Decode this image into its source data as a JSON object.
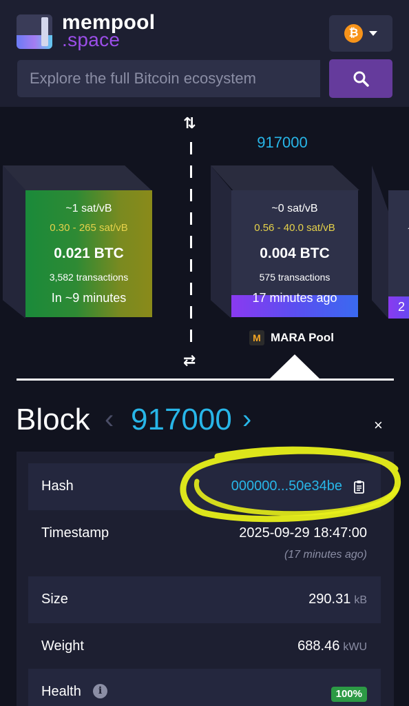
{
  "header": {
    "logo_line1": "mempool",
    "logo_line2": ".space",
    "network_icon": "bitcoin-icon",
    "search_placeholder": "Explore the full Bitcoin ecosystem",
    "search_icon": "search-icon"
  },
  "blockchain": {
    "selected_height": "917000",
    "pending_block": {
      "fee_median": "~1 sat/vB",
      "fee_range": "0.30 - 265 sat/vB",
      "total": "0.021 BTC",
      "tx_count": "3,582 transactions",
      "eta": "In ~9 minutes"
    },
    "confirmed_block": {
      "fee_median": "~0 sat/vB",
      "fee_range": "0.56 - 40.0 sat/vB",
      "total": "0.004 BTC",
      "tx_count": "575 transactions",
      "time_ago": "17 minutes ago",
      "pool_icon_letter": "M",
      "pool_name": "MARA Pool"
    },
    "next_block_peek": {
      "top": "~",
      "bottom": "2"
    }
  },
  "block": {
    "title": "Block",
    "height": "917000",
    "prev_label": "‹",
    "next_label": "›",
    "close_label": "×",
    "rows": {
      "hash": {
        "label": "Hash",
        "value": "000000...50e34be"
      },
      "timestamp": {
        "label": "Timestamp",
        "value": "2025-09-29 18:47:00",
        "relative": "(17 minutes ago)"
      },
      "size": {
        "label": "Size",
        "value": "290.31",
        "unit": "kB"
      },
      "weight": {
        "label": "Weight",
        "value": "688.46",
        "unit": "kWU"
      },
      "health": {
        "label": "Health",
        "info": "i",
        "value": "100%"
      }
    }
  },
  "colors": {
    "accent_blue": "#28b6e8",
    "accent_purple": "#653b9c",
    "fee_yellow": "#e6d24a",
    "health_green": "#2c9a45",
    "highlight": "#e8f01a"
  }
}
